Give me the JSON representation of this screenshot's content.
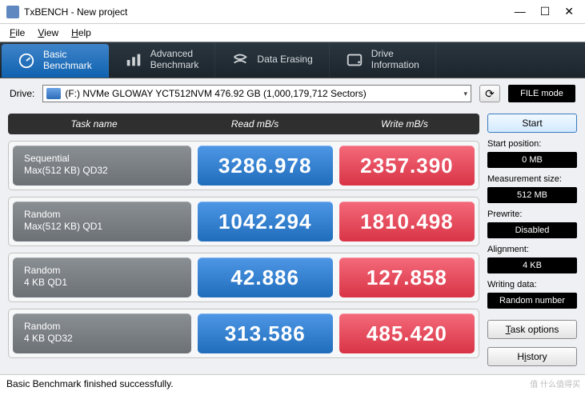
{
  "window": {
    "title": "TxBENCH - New project"
  },
  "menu": {
    "file": "File",
    "view": "View",
    "help": "Help"
  },
  "tabs": {
    "basic": "Basic\nBenchmark",
    "advanced": "Advanced\nBenchmark",
    "erase": "Data Erasing",
    "drive": "Drive\nInformation"
  },
  "drivebar": {
    "label": "Drive:",
    "selected": "(F:) NVMe GLOWAY YCT512NVM  476.92 GB (1,000,179,712 Sectors)",
    "filemode": "FILE mode"
  },
  "headers": {
    "task": "Task name",
    "read": "Read mB/s",
    "write": "Write mB/s"
  },
  "rows": [
    {
      "name1": "Sequential",
      "name2": "Max(512 KB) QD32",
      "read": "3286.978",
      "write": "2357.390"
    },
    {
      "name1": "Random",
      "name2": "Max(512 KB) QD1",
      "read": "1042.294",
      "write": "1810.498"
    },
    {
      "name1": "Random",
      "name2": "4 KB QD1",
      "read": "42.886",
      "write": "127.858"
    },
    {
      "name1": "Random",
      "name2": "4 KB QD32",
      "read": "313.586",
      "write": "485.420"
    }
  ],
  "side": {
    "start": "Start",
    "startpos_l": "Start position:",
    "startpos_v": "0 MB",
    "meas_l": "Measurement size:",
    "meas_v": "512 MB",
    "prewrite_l": "Prewrite:",
    "prewrite_v": "Disabled",
    "align_l": "Alignment:",
    "align_v": "4 KB",
    "wdata_l": "Writing data:",
    "wdata_v": "Random number",
    "taskopt": "Task options",
    "history": "History"
  },
  "status": "Basic Benchmark finished successfully.",
  "watermark": "值 什么值得买"
}
